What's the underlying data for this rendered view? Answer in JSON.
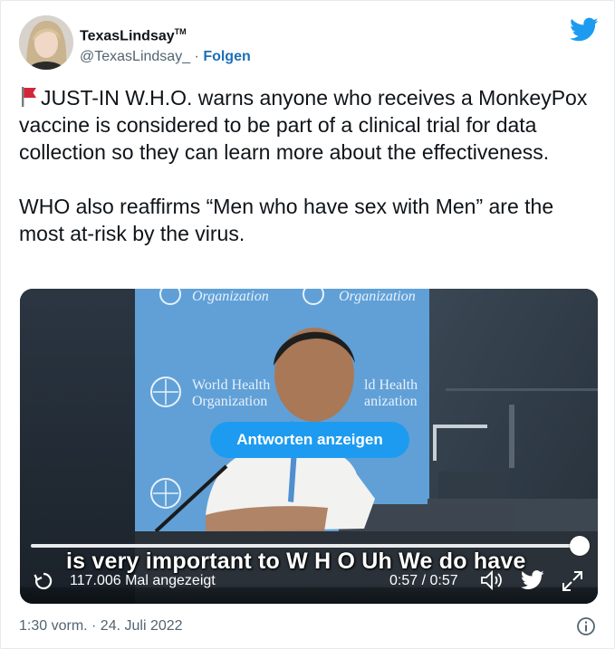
{
  "author": {
    "display_name": "TexasLindsay",
    "trademark": "TM",
    "handle": "@TexasLindsay_",
    "separator": " · ",
    "follow_label": "Folgen"
  },
  "tweet": {
    "paragraph1": "JUST-IN W.H.O. warns anyone who receives a MonkeyPox vaccine is considered to be part of a clinical trial for data collection so they can learn more about the effectiveness.",
    "paragraph2": "WHO also reaffirms “Men who have sex with Men” are the most at-risk by the virus."
  },
  "video": {
    "backdrop_word": "Organization",
    "backdrop_org_line1": "World Health",
    "backdrop_org_line2": "Organization",
    "backdrop_partial_1": "ld Health",
    "backdrop_partial_2": "anization",
    "reply_button": "Antworten anzeigen",
    "caption": "is very important to W H O Uh We do have",
    "views": "117.006 Mal angezeigt",
    "time": "0:57 / 0:57",
    "progress": 1.0
  },
  "footer": {
    "timestamp": "1:30 vorm. · 24. Juli 2022"
  },
  "colors": {
    "twitter_blue": "#1d9bf0",
    "follow_blue": "#1d6fb8",
    "flag_red": "#d0273a",
    "backdrop_blue": "#5b9bd5"
  },
  "icons": [
    "twitter-bird-icon",
    "red-flag-icon",
    "replay-icon",
    "volume-icon",
    "expand-icon",
    "info-icon"
  ]
}
